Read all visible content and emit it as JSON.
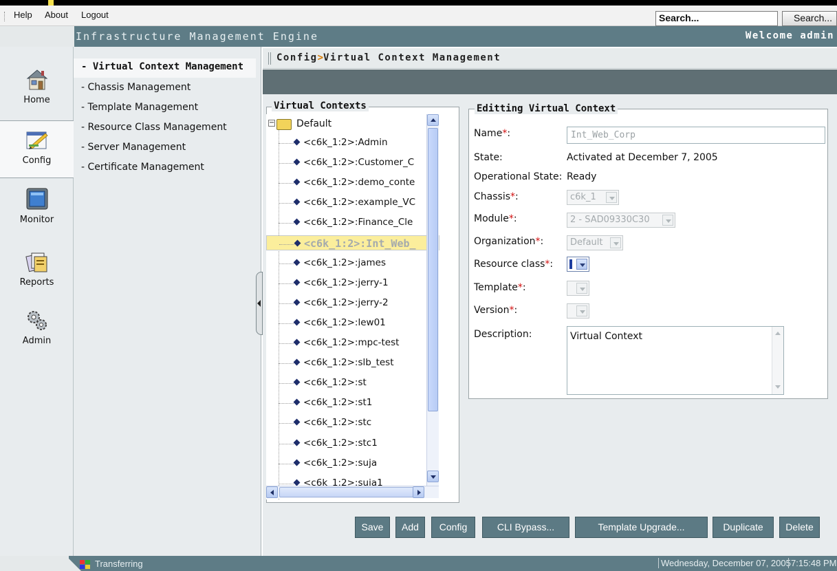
{
  "menu": {
    "help": "Help",
    "about": "About",
    "logout": "Logout"
  },
  "search": {
    "value": "Search...",
    "button": "Search..."
  },
  "app": {
    "title": "Infrastructure Management Engine",
    "welcome": "Welcome admin"
  },
  "nav": [
    {
      "label": "Home",
      "icon": "home-icon"
    },
    {
      "label": "Config",
      "icon": "config-icon",
      "active": true
    },
    {
      "label": "Monitor",
      "icon": "monitor-icon"
    },
    {
      "label": "Reports",
      "icon": "reports-icon"
    },
    {
      "label": "Admin",
      "icon": "admin-gears-icon"
    }
  ],
  "subnav": [
    "Virtual Context Management",
    "Chassis Management",
    "Template Management",
    "Resource Class Management",
    "Server Management",
    "Certificate Management"
  ],
  "breadcrumb": {
    "section": "Config",
    "separator": ">",
    "page": "Virtual Context Management"
  },
  "contexts": {
    "legend": "Virtual Contexts",
    "root": "Default",
    "items": [
      "<c6k_1:2>:Admin",
      "<c6k_1:2>:Customer_C",
      "<c6k_1:2>:demo_conte",
      "<c6k_1:2>:example_VC",
      "<c6k_1:2>:Finance_Cle",
      "<c6k_1:2>:Int_Web_",
      "<c6k_1:2>:james",
      "<c6k_1:2>:jerry-1",
      "<c6k_1:2>:jerry-2",
      "<c6k_1:2>:lew01",
      "<c6k_1:2>:mpc-test",
      "<c6k_1:2>:slb_test",
      "<c6k_1:2>:st",
      "<c6k_1:2>:st1",
      "<c6k_1:2>:stc",
      "<c6k_1:2>:stc1",
      "<c6k_1:2>:suja",
      "<c6k_1:2>:suja1"
    ],
    "selected_index": 5
  },
  "editor": {
    "legend": "Editting Virtual Context",
    "name_label": "Name",
    "name_value": "Int_Web_Corp",
    "state_label": "State:",
    "state_value": "Activated at December 7, 2005",
    "opstate_label": "Operational State:",
    "opstate_value": "Ready",
    "chassis_label": "Chassis",
    "chassis_value": "c6k_1",
    "module_label": "Module",
    "module_value": "2 - SAD09330C30",
    "org_label": "Organization",
    "org_value": "Default",
    "resource_label": "Resource class",
    "template_label": "Template",
    "version_label": "Version",
    "description_label": "Description:",
    "description_value": "Virtual Context",
    "required_mark": "*",
    "colon": ":"
  },
  "actions": [
    "Save",
    "Add",
    "Config",
    "CLI Bypass...",
    "Template Upgrade...",
    "Duplicate",
    "Delete"
  ],
  "status": {
    "text": "Transferring",
    "date": "Wednesday, December 07, 2005",
    "time": "7:15:48 PM"
  },
  "colors": {
    "header": "#5e7c86",
    "panel": "#e8ecee",
    "selected_row": "#fbee9c",
    "button": "#5c7a84",
    "required": "#d21010"
  }
}
